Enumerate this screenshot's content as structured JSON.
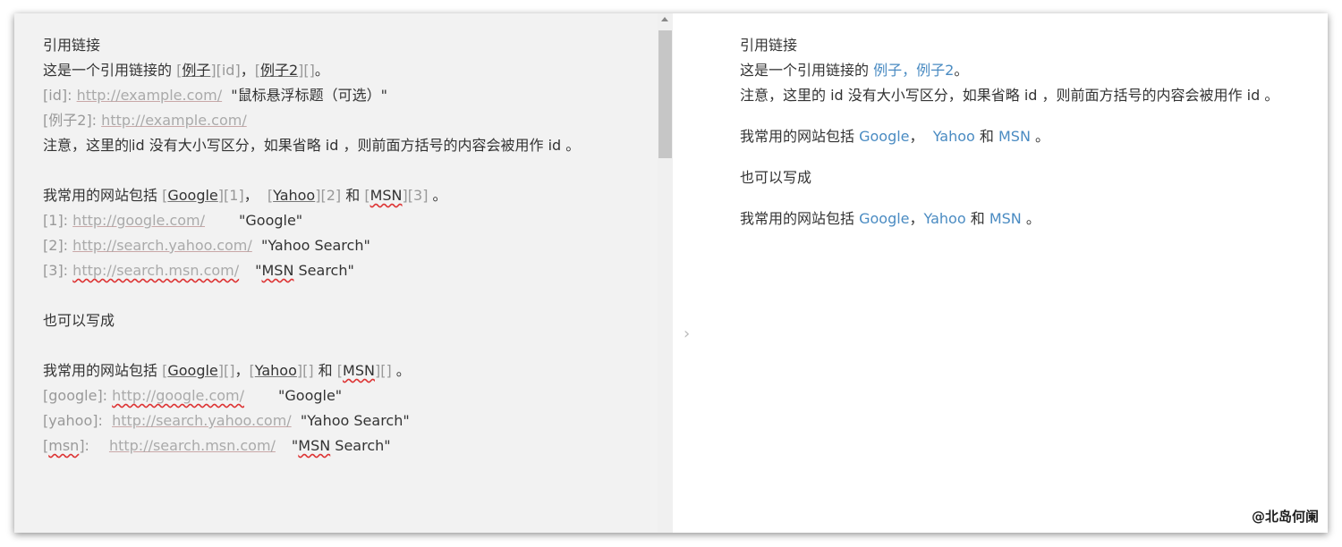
{
  "editor": {
    "line1": "引用链接",
    "line2": {
      "prefix": "这是一个引用链接的 ",
      "t1": "例子",
      "r1": "id",
      "sep": "，",
      "t2": "例子2",
      "r2": "",
      "suffix": "。"
    },
    "line3": {
      "ref": "id",
      "url": "http://example.com/",
      "title": "\"鼠标悬浮标题（可选）\""
    },
    "line4": {
      "ref": "例子2",
      "url": "http://example.com/"
    },
    "line5": {
      "before": "注意，这里的",
      "after": "id 没有大小写区分，如果省略 id ，则前面方括号的内容会被用作 id 。"
    },
    "line7": {
      "prefix": "我常用的网站包括 ",
      "l1": "Google",
      "r1": "1",
      "s1": "，  ",
      "l2": "Yahoo",
      "r2": "2",
      "s2": " 和 ",
      "l3": "MSN",
      "r3": "3",
      "suffix": " 。"
    },
    "refs1": [
      {
        "ref": "1",
        "url": "http://google.com/",
        "title": "\"Google\""
      },
      {
        "ref": "2",
        "url": "http://search.yahoo.com/",
        "title": "\"Yahoo Search\""
      },
      {
        "ref": "3",
        "url": "http://search.msn.com/",
        "title_q": "\"",
        "title_w": "MSN",
        "title_r": " Search\""
      }
    ],
    "line12": "也可以写成",
    "line14": {
      "prefix": "我常用的网站包括 ",
      "l1": "Google",
      "s1": "，",
      "l2": "Yahoo",
      "s2": " 和 ",
      "l3": "MSN",
      "suffix": " 。"
    },
    "refs2": [
      {
        "ref": "google",
        "url": "http://google.com/",
        "title": "\"Google\""
      },
      {
        "ref": "yahoo",
        "url": "http://search.yahoo.com/",
        "title": "\"Yahoo Search\""
      },
      {
        "ref": "msn",
        "url": "http://search.msn.com/",
        "title_q": "\"",
        "title_w": "MSN",
        "title_r": " Search\""
      }
    ]
  },
  "preview": {
    "p1": "引用链接",
    "p2": {
      "prefix": "这是一个引用链接的 ",
      "l1": "例子",
      "sep": "，",
      "l2": "例子2",
      "suffix": "。"
    },
    "p3": "注意，这里的 id 没有大小写区分，如果省略 id ，则前面方括号的内容会被用作 id 。",
    "p4": {
      "prefix": "我常用的网站包括 ",
      "l1": "Google",
      "s1": "，  ",
      "l2": "Yahoo",
      "s2": " 和 ",
      "l3": "MSN",
      "suffix": " 。"
    },
    "p5": "也可以写成",
    "p6": {
      "prefix": "我常用的网站包括 ",
      "l1": "Google",
      "s1": "，",
      "l2": "Yahoo",
      "s2": " 和 ",
      "l3": "MSN",
      "suffix": " 。"
    }
  },
  "splitter_glyph": "›",
  "watermark": "@北岛何阑",
  "colors": {
    "link": "#4a8bc2",
    "editor_bg": "#f2f2f2",
    "bracket": "#999999"
  }
}
